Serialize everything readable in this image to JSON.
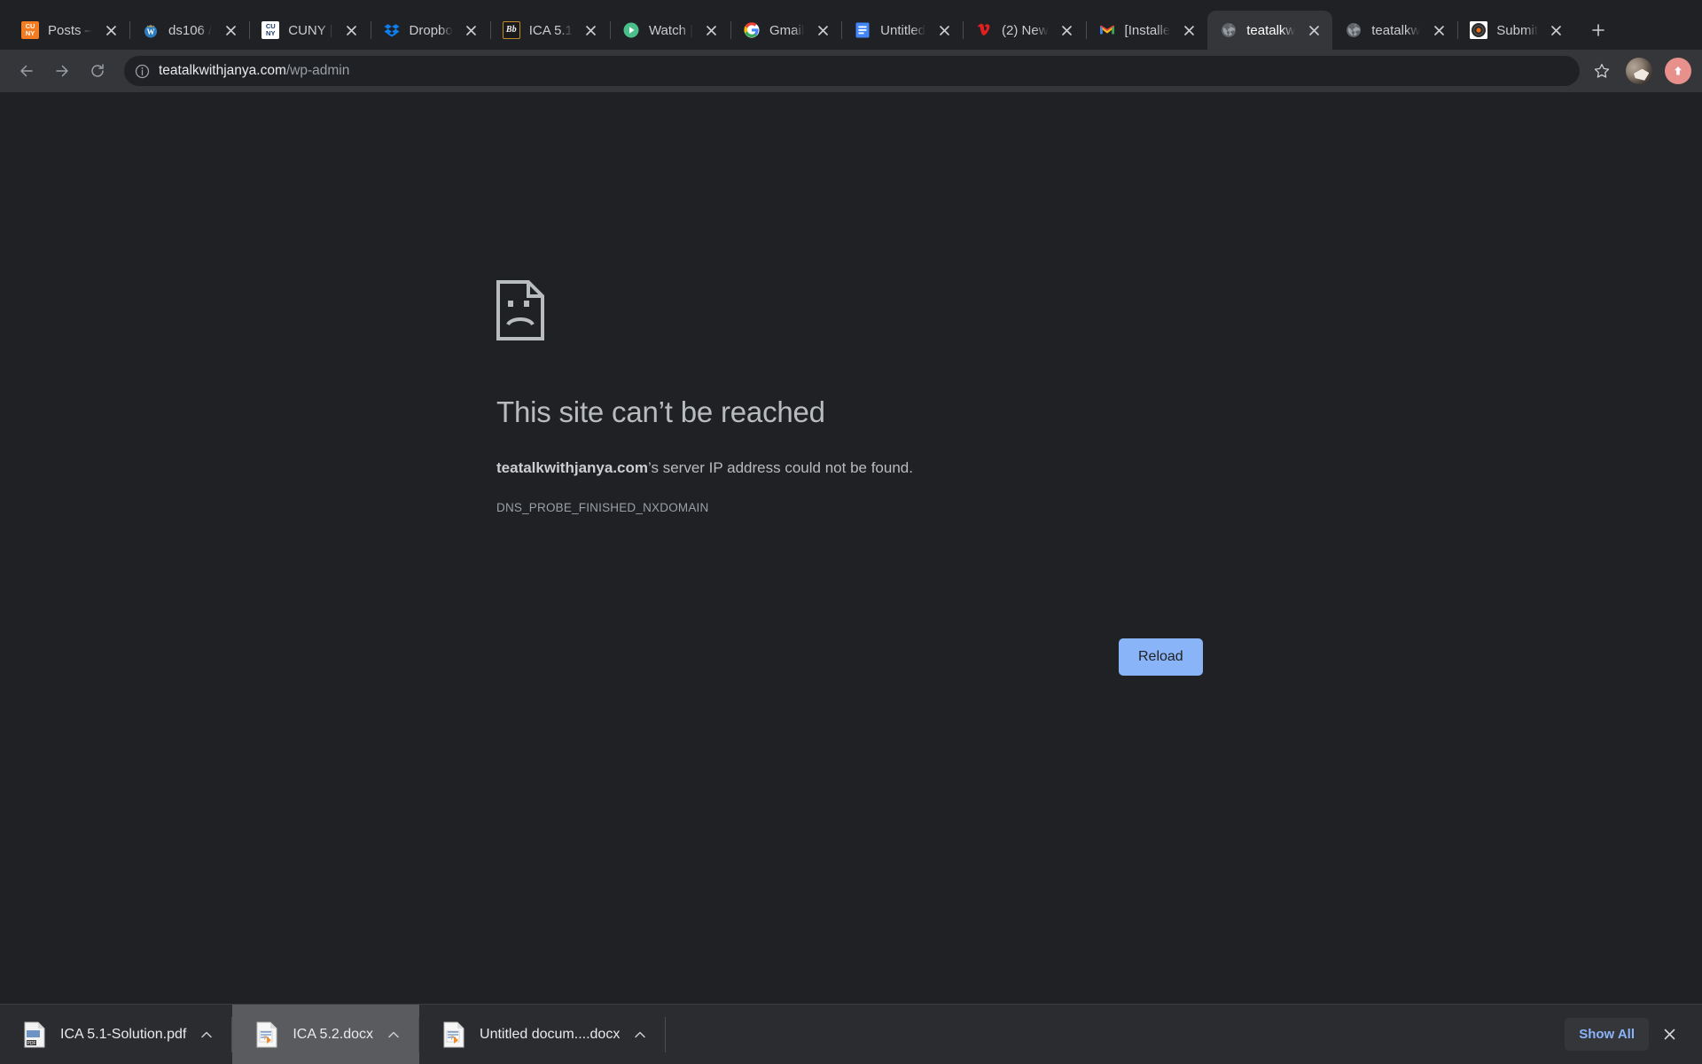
{
  "browser": {
    "tabs": [
      {
        "title": "Posts –",
        "favicon": "cuny-orange-icon",
        "active": false
      },
      {
        "title": "ds106 /",
        "favicon": "ds106-wordpress-icon",
        "active": false
      },
      {
        "title": "CUNY |",
        "favicon": "cuny-white-icon",
        "active": false
      },
      {
        "title": "Dropbo",
        "favicon": "dropbox-icon",
        "active": false
      },
      {
        "title": "ICA 5.1",
        "favicon": "blackboard-icon",
        "active": false
      },
      {
        "title": "Watch |",
        "favicon": "watch-play-icon",
        "active": false
      },
      {
        "title": "Gmail",
        "favicon": "google-icon",
        "active": false
      },
      {
        "title": "Untitled",
        "favicon": "google-docs-icon",
        "active": false
      },
      {
        "title": "(2) New",
        "favicon": "vimeo-icon",
        "active": false
      },
      {
        "title": "[Installe",
        "favicon": "gmail-icon",
        "active": false
      },
      {
        "title": "teatalkw",
        "favicon": "globe-icon",
        "active": true
      },
      {
        "title": "teatalkw",
        "favicon": "globe-icon",
        "active": false
      },
      {
        "title": "Submit",
        "favicon": "vinyl-record-icon",
        "active": false
      }
    ],
    "new_tab_label": "+",
    "toolbar": {
      "back_label": "Back",
      "forward_label": "Forward",
      "reload_label": "Reload page",
      "url_host": "teatalkwithjanya.com",
      "url_path": "/wp-admin",
      "url_full": "teatalkwithjanya.com/wp-admin",
      "site_info_label": "View site information",
      "bookmark_label": "Bookmark this tab",
      "profile_label": "Profile",
      "extension_label": "Extension"
    }
  },
  "error_page": {
    "icon": "sad-page-icon",
    "heading": "This site can’t be reached",
    "detail_host": "teatalkwithjanya.com",
    "detail_rest": "’s server IP address could not be found.",
    "error_code": "DNS_PROBE_FINISHED_NXDOMAIN",
    "reload_button": "Reload"
  },
  "download_shelf": {
    "items": [
      {
        "name": "ICA 5.1-Solution.pdf",
        "icon": "pdf-file-icon",
        "highlight": false
      },
      {
        "name": "ICA 5.2.docx",
        "icon": "docx-file-icon",
        "highlight": true
      },
      {
        "name": "Untitled docum....docx",
        "icon": "docx-file-icon",
        "highlight": false
      }
    ],
    "show_all_label": "Show All",
    "close_label": "Close downloads bar"
  },
  "colors": {
    "chrome_bg": "#202124",
    "toolbar_bg": "#35363A",
    "accent_blue": "#8AB4F8",
    "shelf_bg": "#2b2c2f"
  }
}
